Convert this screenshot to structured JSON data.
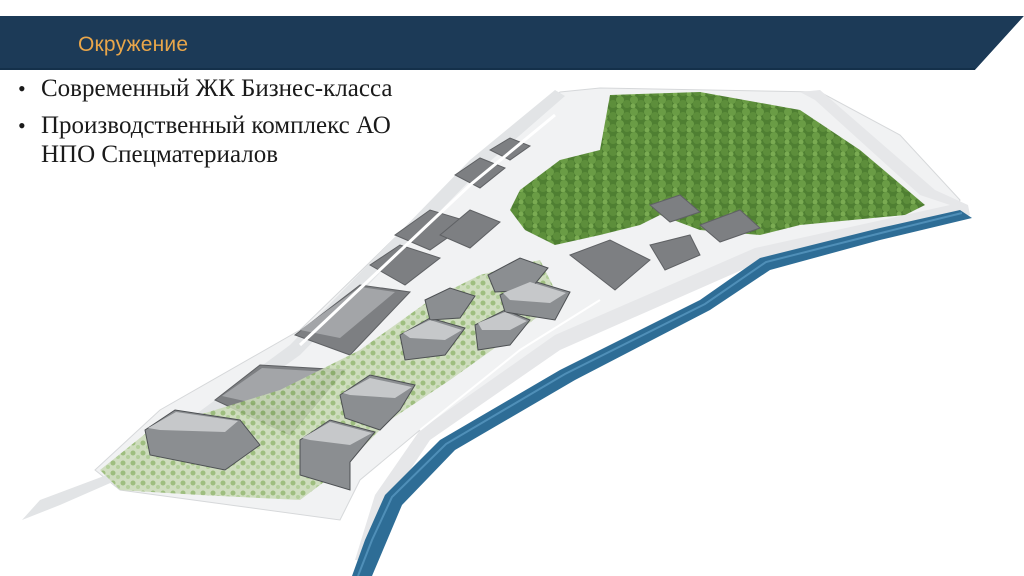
{
  "header": {
    "title": "Окружение",
    "bar_color": "#1c3a57",
    "title_color": "#e9a64a"
  },
  "bullets": [
    {
      "text": "Современный ЖК Бизнес-класса"
    },
    {
      "text": "Производственный комплекс АО НПО Спецматериалов"
    }
  ],
  "illustration": {
    "subject": "aerial-render-residential-complex-forest-river",
    "colors": {
      "forest": "#5b8a3a",
      "river": "#2e6d96",
      "road": "#e4e6e8",
      "industrial": "#7a7c7e",
      "residential": "#8a8d90"
    }
  }
}
